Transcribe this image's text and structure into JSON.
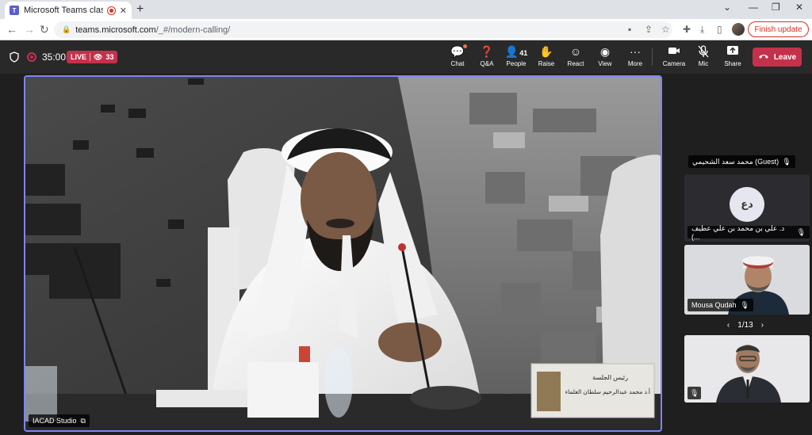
{
  "browser": {
    "tab_title": "Microsoft Teams classic",
    "tab_close": "✕",
    "new_tab": "+",
    "url_host": "teams.microsoft.com",
    "url_path": "/_#/modern-calling/",
    "finish_update_label": "Finish update"
  },
  "meeting": {
    "timer": "35:00",
    "live_label": "LIVE",
    "viewer_count": "33",
    "toolbar": {
      "chat": "Chat",
      "qa": "Q&A",
      "people": "People",
      "people_count": "41",
      "raise": "Raise",
      "react": "React",
      "view": "View",
      "more": "More",
      "camera": "Camera",
      "mic": "Mic",
      "share": "Share"
    },
    "leave_label": "Leave"
  },
  "stage": {
    "main_name": "IACAD Studio",
    "desk_sign_line1": "رئيس الجلسة",
    "desk_sign_line2": "أ.د محمد عبدالرحيم سلطان العلماء",
    "guest_label": "محمد سعد الشحيمي (Guest)",
    "avatar_initials": "دع",
    "avatar_tile_name": "د. علي بن محمد بن علي عطيف (...",
    "second_tile_name": "Mousa Qudah",
    "pager": "1/13"
  },
  "colors": {
    "accent": "#7f85f5",
    "leave": "#c4314b",
    "teams_purple": "#5b5fc7"
  },
  "icons": [
    "shield-icon",
    "record-icon",
    "eye-icon",
    "chat-icon",
    "qa-icon",
    "people-icon",
    "raise-hand-icon",
    "react-icon",
    "view-icon",
    "more-icon",
    "camera-icon",
    "mic-off-icon",
    "share-icon",
    "phone-hangup-icon"
  ]
}
